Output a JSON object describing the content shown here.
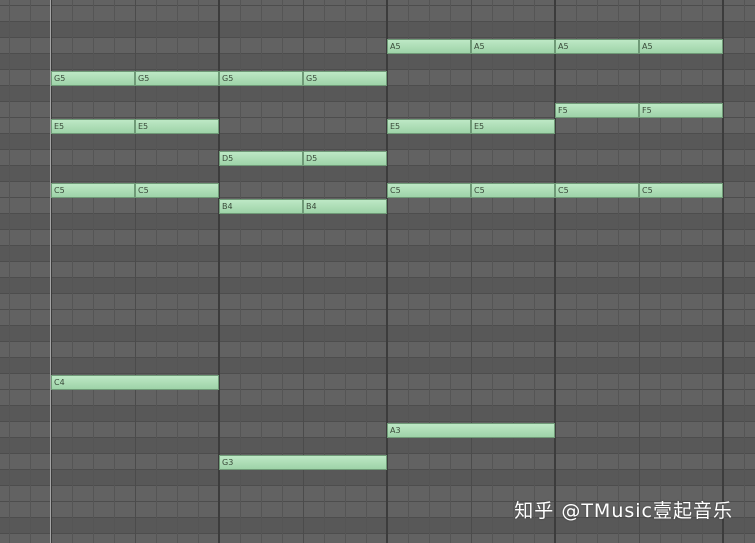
{
  "piano_roll": {
    "colors": {
      "note_fill": "#a9dcb2",
      "note_border": "#6f9a77",
      "white_row": "#626262",
      "black_row": "#585858"
    },
    "notes": [
      {
        "pitch": "A5",
        "beat": 32,
        "length": 8
      },
      {
        "pitch": "A5",
        "beat": 40,
        "length": 8
      },
      {
        "pitch": "A5",
        "beat": 48,
        "length": 8
      },
      {
        "pitch": "A5",
        "beat": 56,
        "length": 8
      },
      {
        "pitch": "G5",
        "beat": 0,
        "length": 8
      },
      {
        "pitch": "G5",
        "beat": 8,
        "length": 8
      },
      {
        "pitch": "G5",
        "beat": 16,
        "length": 8
      },
      {
        "pitch": "G5",
        "beat": 24,
        "length": 8
      },
      {
        "pitch": "F5",
        "beat": 48,
        "length": 8
      },
      {
        "pitch": "F5",
        "beat": 56,
        "length": 8
      },
      {
        "pitch": "E5",
        "beat": 0,
        "length": 8
      },
      {
        "pitch": "E5",
        "beat": 8,
        "length": 8
      },
      {
        "pitch": "E5",
        "beat": 32,
        "length": 8
      },
      {
        "pitch": "E5",
        "beat": 40,
        "length": 8
      },
      {
        "pitch": "D5",
        "beat": 16,
        "length": 8
      },
      {
        "pitch": "D5",
        "beat": 24,
        "length": 8
      },
      {
        "pitch": "C5",
        "beat": 0,
        "length": 8
      },
      {
        "pitch": "C5",
        "beat": 8,
        "length": 8
      },
      {
        "pitch": "C5",
        "beat": 32,
        "length": 8
      },
      {
        "pitch": "C5",
        "beat": 40,
        "length": 8
      },
      {
        "pitch": "C5",
        "beat": 48,
        "length": 8
      },
      {
        "pitch": "C5",
        "beat": 56,
        "length": 8
      },
      {
        "pitch": "B4",
        "beat": 16,
        "length": 8
      },
      {
        "pitch": "B4",
        "beat": 24,
        "length": 8
      },
      {
        "pitch": "C4",
        "beat": 0,
        "length": 16
      },
      {
        "pitch": "A3",
        "beat": 32,
        "length": 16
      },
      {
        "pitch": "G3",
        "beat": 16,
        "length": 16
      }
    ]
  },
  "watermark": {
    "text": "知乎 @TMusic壹起音乐"
  }
}
